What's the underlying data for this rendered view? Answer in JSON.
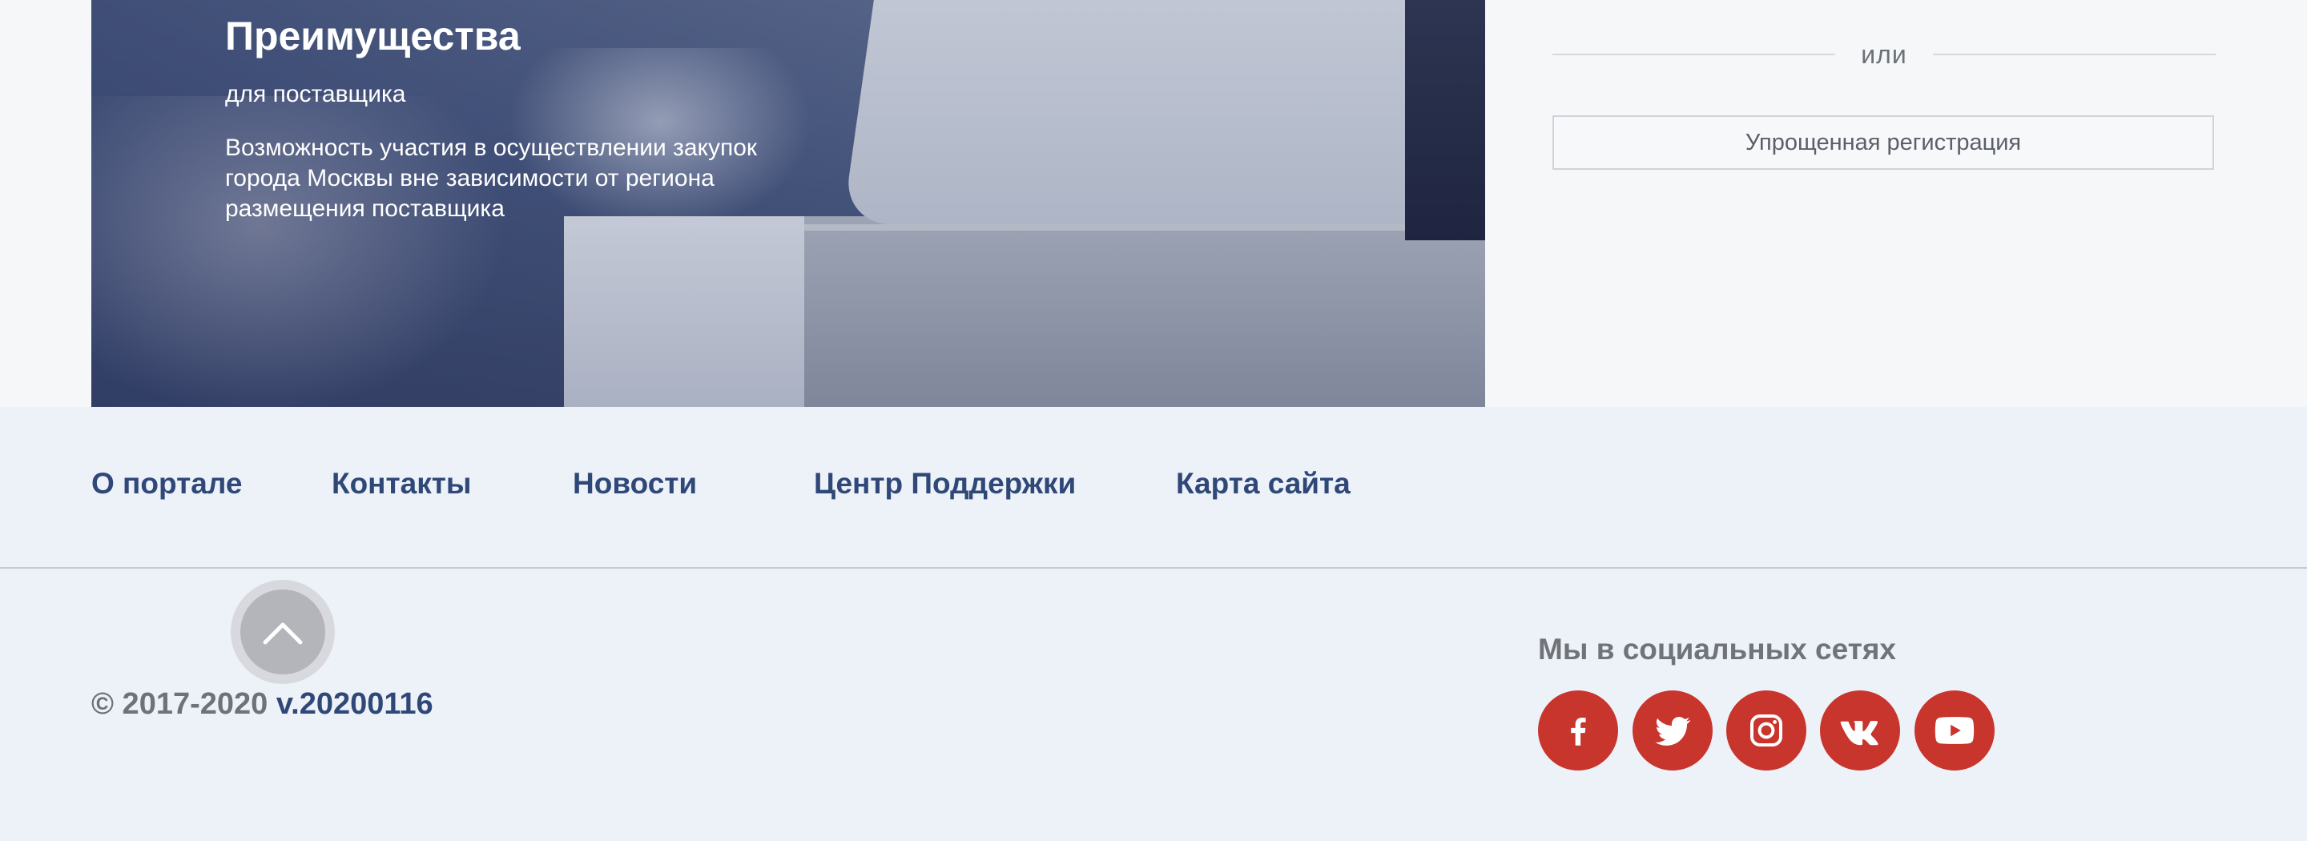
{
  "hero": {
    "title": "Преимущества",
    "subtitle": "для поставщика",
    "description": "Возможность участия в осуществлении закупок города Москвы вне зависимости от региона размещения поставщика"
  },
  "auth": {
    "or_label": "или",
    "simple_registration_label": "Упрощенная регистрация"
  },
  "footer": {
    "nav": [
      {
        "label": "О портале"
      },
      {
        "label": "Контакты"
      },
      {
        "label": "Новости"
      },
      {
        "label": "Центр Поддержки"
      },
      {
        "label": "Карта сайта"
      }
    ],
    "copyright": "© 2017-2020",
    "version": "v.20200116",
    "social_title": "Мы в социальных сетях",
    "social": [
      {
        "icon": "facebook-icon"
      },
      {
        "icon": "twitter-icon"
      },
      {
        "icon": "instagram-icon"
      },
      {
        "icon": "vk-icon"
      },
      {
        "icon": "youtube-icon"
      }
    ],
    "accent_color": "#c8352c",
    "link_color": "#2f4878"
  }
}
